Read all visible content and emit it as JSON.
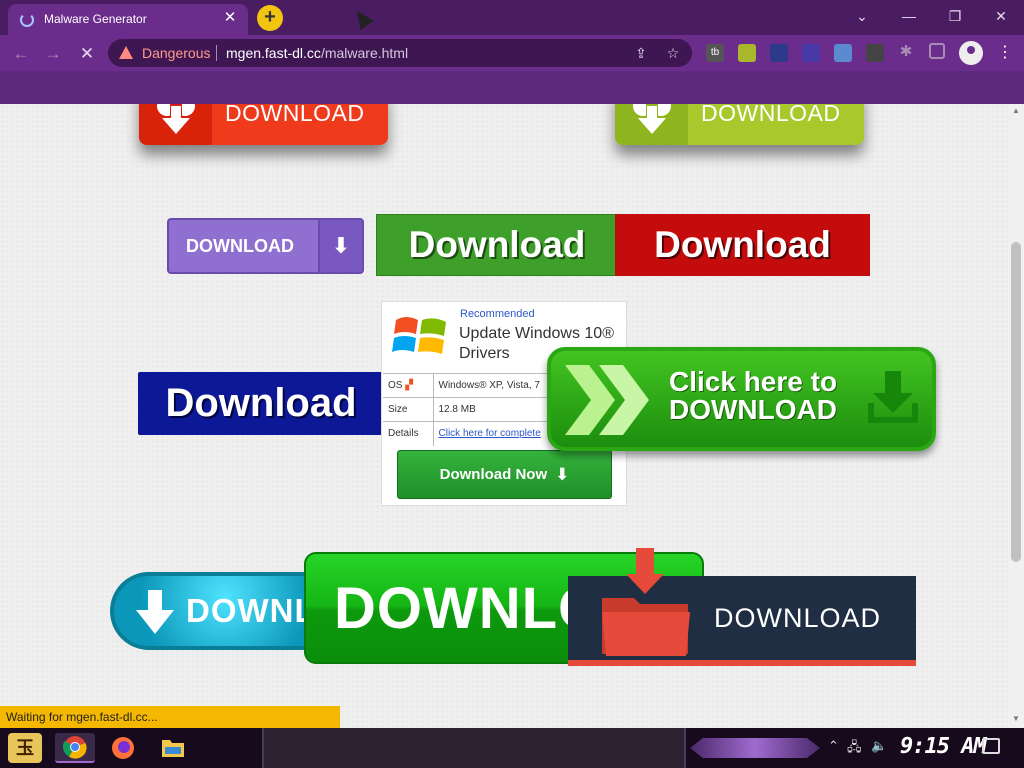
{
  "browser": {
    "tab_title": "Malware Generator",
    "tab_close": "✕",
    "new_tab": "+",
    "window_controls": {
      "minimize": "⌄",
      "min": "—",
      "restore": "❐",
      "close": "✕"
    },
    "security_warning": "Dangerous",
    "url_host": "mgen.fast-dl.cc",
    "url_path": "/malware.html",
    "back": "←",
    "forward": "→",
    "reload": "✕",
    "share": "⇪",
    "star": "☆",
    "menu": "⋮",
    "extensions": [
      {
        "name": "tb-extension-icon",
        "label": "tb",
        "color": "#555"
      },
      {
        "name": "game-extension-icon",
        "label": "",
        "color": "#a8b82a"
      },
      {
        "name": "person-extension-icon",
        "label": "",
        "color": "#2b3a8a"
      },
      {
        "name": "search-extension-icon",
        "label": "",
        "color": "#4a3aa8"
      },
      {
        "name": "photo-extension-icon",
        "label": "",
        "color": "#5a8ad0"
      },
      {
        "name": "camera-extension-icon",
        "label": "",
        "color": "#444"
      }
    ]
  },
  "page": {
    "top_left_label": "DOWNLOAD",
    "top_right_label": "DOWNLOAD",
    "purple_label": "DOWNLOAD",
    "purple_arrow": "⬇",
    "green_flat_label": "Download",
    "red_flat_label": "Download",
    "navy_label": "Download",
    "ad": {
      "recommended": "Recommended",
      "title": "Update Windows 10® Drivers",
      "rows": [
        {
          "key": "OS",
          "value": "Windows® XP, Vista, 7"
        },
        {
          "key": "Size",
          "value": "12.8 MB"
        },
        {
          "key": "Details",
          "value": "Click here for complete"
        }
      ],
      "button_label": "Download Now",
      "button_arrow": "⬇"
    },
    "click_here_line1": "Click here to",
    "click_here_line2": "DOWNLOAD",
    "cyan_label": "DOWNLOAD",
    "big_green_label": "DOWNLOAD",
    "folder_label": "DOWNLOAD"
  },
  "status_bar": "Waiting for mgen.fast-dl.cc...",
  "taskbar": {
    "start_label": "玉",
    "clock": "9:15 AM",
    "tray": {
      "up": "⌃",
      "network": "🖧",
      "volume": "🔈"
    }
  }
}
